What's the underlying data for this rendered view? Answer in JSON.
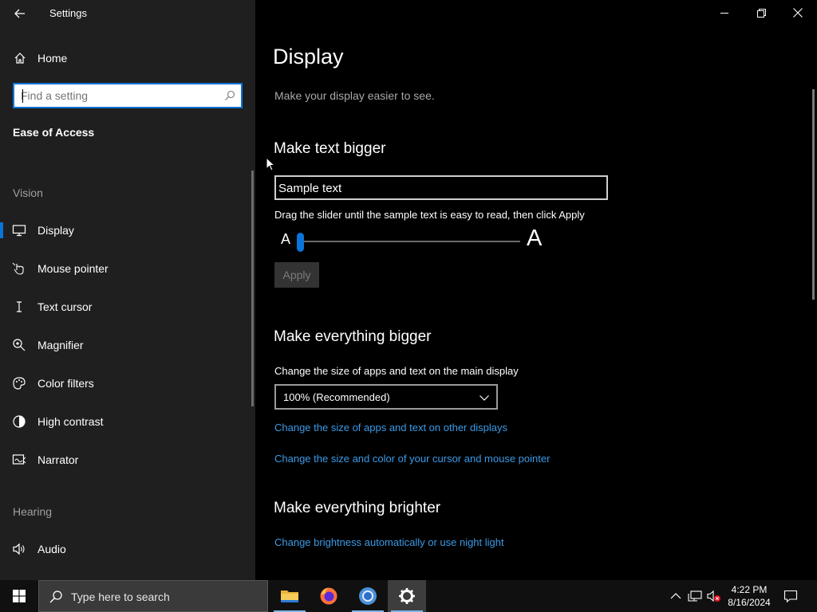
{
  "window": {
    "title": "Settings"
  },
  "sidebar": {
    "home_label": "Home",
    "search_placeholder": "Find a setting",
    "section_title": "Ease of Access",
    "groups": [
      {
        "label": "Vision",
        "items": [
          {
            "label": "Display",
            "icon": "monitor-icon",
            "active": true
          },
          {
            "label": "Mouse pointer",
            "icon": "mouse-pointer-icon"
          },
          {
            "label": "Text cursor",
            "icon": "text-cursor-icon"
          },
          {
            "label": "Magnifier",
            "icon": "magnifier-icon"
          },
          {
            "label": "Color filters",
            "icon": "color-filters-icon"
          },
          {
            "label": "High contrast",
            "icon": "high-contrast-icon"
          },
          {
            "label": "Narrator",
            "icon": "narrator-icon"
          }
        ]
      },
      {
        "label": "Hearing",
        "items": [
          {
            "label": "Audio",
            "icon": "audio-icon"
          }
        ]
      }
    ]
  },
  "main": {
    "title": "Display",
    "subtitle": "Make your display easier to see.",
    "text_bigger": {
      "heading": "Make text bigger",
      "sample_text": "Sample text",
      "instruction": "Drag the slider until the sample text is easy to read, then click Apply",
      "slider_min_glyph": "A",
      "slider_max_glyph": "A",
      "slider_value": 0,
      "apply_label": "Apply"
    },
    "everything_bigger": {
      "heading": "Make everything bigger",
      "description": "Change the size of apps and text on the main display",
      "dropdown_value": "100% (Recommended)",
      "link_other_displays": "Change the size of apps and text on other displays",
      "link_cursor": "Change the size and color of your cursor and mouse pointer"
    },
    "everything_brighter": {
      "heading": "Make everything brighter",
      "link_brightness": "Change brightness automatically or use night light"
    }
  },
  "taskbar": {
    "search_placeholder": "Type here to search",
    "apps": [
      "file-explorer-icon",
      "firefox-icon",
      "chrome-icon",
      "settings-icon"
    ],
    "time": "4:22 PM",
    "date": "8/16/2024"
  },
  "colors": {
    "accent": "#0a74d9",
    "link": "#3b9ae6",
    "sidebar_bg": "#1f1f1f",
    "main_bg": "#000000"
  }
}
